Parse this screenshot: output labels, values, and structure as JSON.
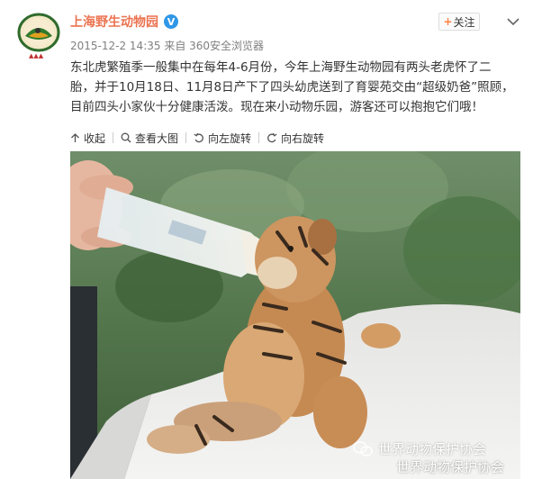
{
  "post": {
    "username": "上海野生动物园",
    "verified_badge": "V",
    "timestamp": "2015-12-2 14:35",
    "source": "来自 360安全浏览器",
    "follow_label": "关注",
    "text": "东北虎繁殖季一般集中在每年4-6月份，今年上海野生动物园有两头老虎怀了二\n胎，并于10月18日、11月8日产下了四头幼虎送到了育婴苑交由“超级奶爸”照顾，\n目前四头小家伙十分健康活泼。现在来小动物乐园，游客还可以抱抱它们哦！"
  },
  "toolbar": {
    "collapse_label": "收起",
    "view_large_label": "查看大图",
    "rotate_left_label": "向左旋转",
    "rotate_right_label": "向右旋转"
  },
  "photo": {
    "watermark": "世界动物保护协会",
    "watermark_secondary": "世界动物保护协会"
  },
  "colors": {
    "username": "#eb7350",
    "badge": "#2f97e7",
    "meta": "#808080",
    "follow_plus": "#ff8140"
  },
  "icons": [
    "zoo-logo-avatar",
    "verified-icon",
    "chevron-down-icon",
    "collapse-icon",
    "search-icon",
    "rotate-left-icon",
    "rotate-right-icon",
    "wechat-icon"
  ]
}
